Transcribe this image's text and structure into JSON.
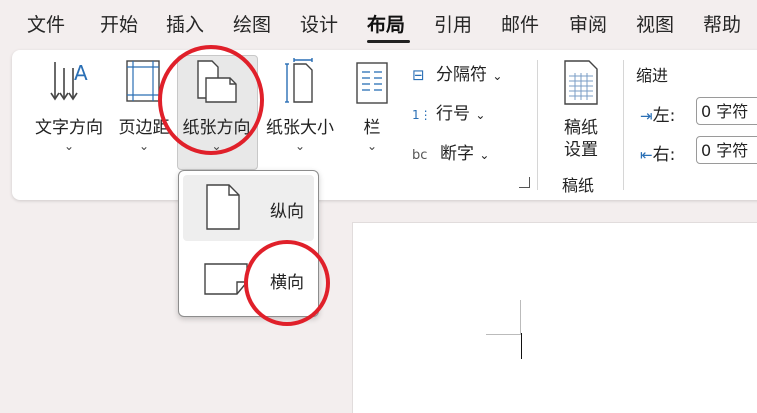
{
  "tabs": [
    "文件",
    "开始",
    "插入",
    "绘图",
    "设计",
    "布局",
    "引用",
    "邮件",
    "审阅",
    "视图",
    "帮助"
  ],
  "active_tab": "布局",
  "ribbon": {
    "text_direction": {
      "label": "文字方向"
    },
    "margins": {
      "label": "页边距"
    },
    "orientation": {
      "label": "纸张方向"
    },
    "size": {
      "label": "纸张大小"
    },
    "columns": {
      "label": "栏"
    },
    "breaks": {
      "label": "分隔符"
    },
    "line_numbers": {
      "label": "行号"
    },
    "hyphenation": {
      "label": "断字"
    },
    "manuscript": {
      "label_line1": "稿纸",
      "label_line2": "设置",
      "group": "稿纸"
    },
    "indent": {
      "group": "缩进",
      "left_label": "左:",
      "left_value": "0 字符",
      "right_label": "右:",
      "right_value": "0 字符"
    },
    "chevron": "⌄"
  },
  "orientation_menu": {
    "portrait": "纵向",
    "landscape": "横向"
  },
  "annotations": {
    "highlight_color": "#e0202a"
  }
}
